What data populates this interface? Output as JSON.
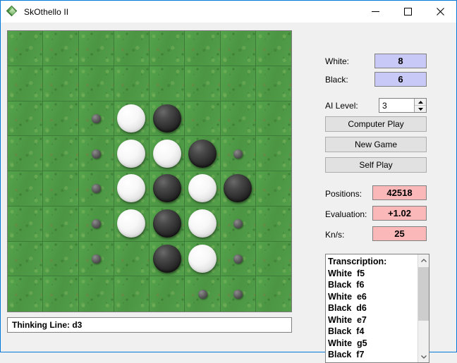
{
  "window": {
    "title": "SkOthello II",
    "icon": "app-diamond-icon",
    "minimize_label": "—",
    "maximize_label": "□",
    "close_label": "✕",
    "accent_color": "#0078d7"
  },
  "panel": {
    "white_label": "White:",
    "white_value": "8",
    "black_label": "Black:",
    "black_value": "6",
    "ai_level_label": "AI Level:",
    "ai_level_value": "3",
    "score_box_color": "#c9c9f7",
    "stat_box_color": "#fbb8b8",
    "buttons": [
      {
        "label": "Computer Play",
        "name": "computer-play-button"
      },
      {
        "label": "New Game",
        "name": "new-game-button"
      },
      {
        "label": "Self Play",
        "name": "self-play-button"
      }
    ],
    "stats": [
      {
        "label": "Positions:",
        "value": "42518"
      },
      {
        "label": "Evaluation:",
        "value": "+1.02"
      },
      {
        "label": "Kn/s:",
        "value": "25"
      }
    ]
  },
  "transcription": {
    "header": "Transcription:",
    "moves": [
      "White  f5",
      "Black  f6",
      "White  e6",
      "Black  d6",
      "White  e7",
      "Black  f4",
      "White  g5",
      "Black  f7"
    ]
  },
  "status": {
    "text": "Thinking Line: d3"
  },
  "board": {
    "size": 8,
    "grass_color": "#4f9c47",
    "grid_line_color": "#3d7c38",
    "cells": [
      "",
      "",
      "",
      "",
      "",
      "",
      "",
      "",
      "",
      "",
      "",
      "",
      "",
      "",
      "",
      "",
      "",
      "",
      "m",
      "W",
      "B",
      "",
      "",
      "",
      "",
      "",
      "m",
      "W",
      "W",
      "B",
      "m",
      "",
      "",
      "",
      "m",
      "W",
      "B",
      "W",
      "B",
      "",
      "",
      "",
      "m",
      "W",
      "B",
      "W",
      "m",
      "",
      "",
      "",
      "m",
      "",
      "B",
      "W",
      "m",
      "",
      "",
      "",
      "",
      "",
      "",
      "m",
      "m",
      ""
    ]
  }
}
